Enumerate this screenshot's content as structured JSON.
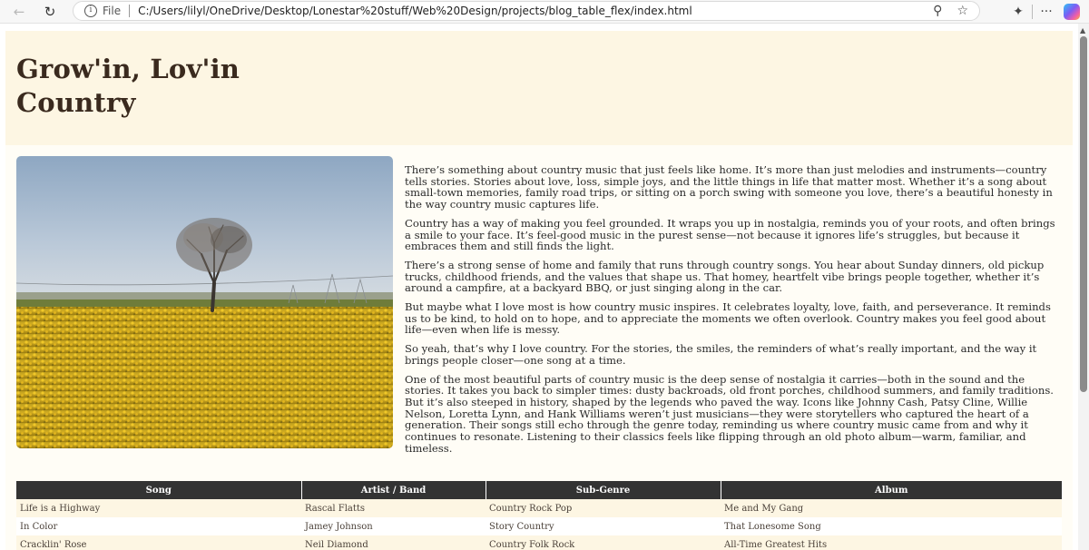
{
  "browser": {
    "protocol_label": "File",
    "url": "C:/Users/lilyl/OneDrive/Desktop/Lonestar%20stuff/Web%20Design/projects/blog_table_flex/index.html",
    "more_label": "···"
  },
  "page": {
    "title_line1": "Grow'in, Lov'in",
    "title_line2": "Country"
  },
  "article": {
    "paragraphs": [
      "There’s something about country music that just feels like home. It’s more than just melodies and instruments—country tells stories. Stories about love, loss, simple joys, and the little things in life that matter most. Whether it’s a song about small-town memories, family road trips, or sitting on a porch swing with someone you love, there’s a beautiful honesty in the way country music captures life.",
      "Country has a way of making you feel grounded. It wraps you up in nostalgia, reminds you of your roots, and often brings a smile to your face. It’s feel-good music in the purest sense—not because it ignores life’s struggles, but because it embraces them and still finds the light.",
      "There’s a strong sense of home and family that runs through country songs. You hear about Sunday dinners, old pickup trucks, childhood friends, and the values that shape us. That homey, heartfelt vibe brings people together, whether it’s around a campfire, at a backyard BBQ, or just singing along in the car.",
      "But maybe what I love most is how country music inspires. It celebrates loyalty, love, faith, and perseverance. It reminds us to be kind, to hold on to hope, and to appreciate the moments we often overlook. Country makes you feel good about life—even when life is messy.",
      "So yeah, that’s why I love country. For the stories, the smiles, the reminders of what’s really important, and the way it brings people closer—one song at a time.",
      "One of the most beautiful parts of country music is the deep sense of nostalgia it carries—both in the sound and the stories. It takes you back to simpler times: dusty backroads, old front porches, childhood summers, and family traditions. But it’s also steeped in history, shaped by the legends who paved the way. Icons like Johnny Cash, Patsy Cline, Willie Nelson, Loretta Lynn, and Hank Williams weren’t just musicians—they were storytellers who captured the heart of a generation. Their songs still echo through the genre today, reminding us where country music came from and why it continues to resonate. Listening to their classics feels like flipping through an old photo album—warm, familiar, and timeless."
    ]
  },
  "table": {
    "headers": [
      "Song",
      "Artist / Band",
      "Sub-Genre",
      "Album"
    ],
    "rows": [
      [
        "Life is a Highway",
        "Rascal Flatts",
        "Country Rock Pop",
        "Me and My Gang"
      ],
      [
        "In Color",
        "Jamey Johnson",
        "Story Country",
        "That Lonesome Song"
      ],
      [
        "Cracklin' Rose",
        "Neil Diamond",
        "Country Folk Rock",
        "All-Time Greatest Hits"
      ]
    ]
  },
  "colors": {
    "banner_bg": "#fdf6e3",
    "title_color": "#3a2a1e",
    "table_header_bg": "#333333"
  }
}
